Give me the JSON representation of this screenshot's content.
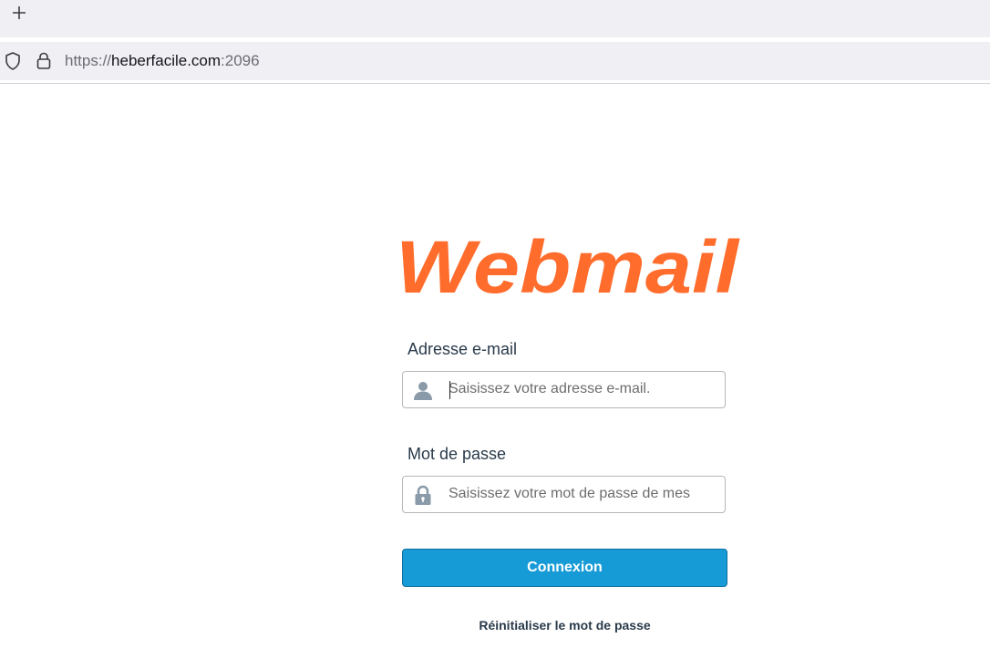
{
  "browser": {
    "new_tab_icon": "plus-icon",
    "url_scheme": "https://",
    "url_host": "heberfacile.com",
    "url_port": ":2096",
    "shield_icon": "shield-icon",
    "lock_icon": "lock-icon"
  },
  "login": {
    "logo_text": "Webmail",
    "logo_color": "#ff6c2c",
    "email": {
      "label": "Adresse e-mail",
      "placeholder": "Saisissez votre adresse e-mail.",
      "value": "",
      "icon": "user-icon"
    },
    "password": {
      "label": "Mot de passe",
      "placeholder": "Saisissez votre mot de passe de mes",
      "value": "",
      "icon": "padlock-icon"
    },
    "submit_label": "Connexion",
    "submit_color": "#179bd7",
    "reset_label": "Réinitialiser le mot de passe"
  }
}
